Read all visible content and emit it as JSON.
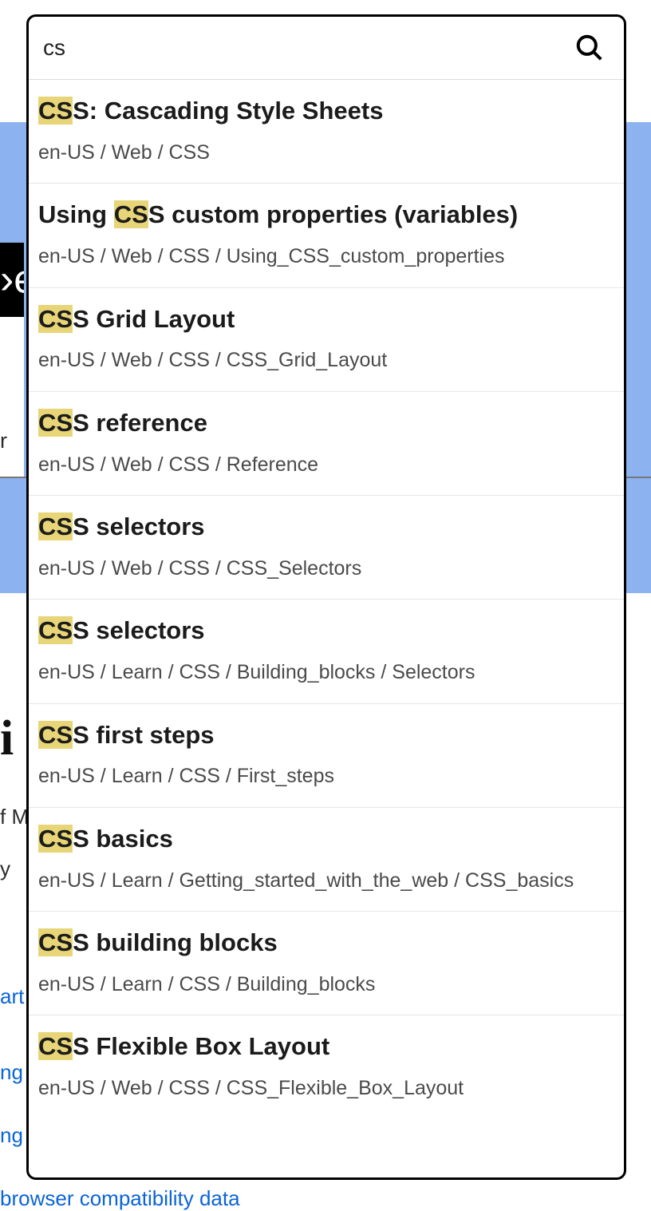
{
  "search": {
    "value": "cs",
    "highlight": "CS"
  },
  "results": [
    {
      "title_before": "",
      "title_after": "S: Cascading Style Sheets",
      "path": "en-US / Web / CSS"
    },
    {
      "pre": "Using ",
      "title_before": "",
      "title_after": "S custom properties (variables)",
      "path": "en-US / Web / CSS / Using_CSS_custom_properties"
    },
    {
      "title_before": "",
      "title_after": "S Grid Layout",
      "path": "en-US / Web / CSS / CSS_Grid_Layout"
    },
    {
      "title_before": "",
      "title_after": "S reference",
      "path": "en-US / Web / CSS / Reference"
    },
    {
      "title_before": "",
      "title_after": "S selectors",
      "path": "en-US / Web / CSS / CSS_Selectors"
    },
    {
      "title_before": "",
      "title_after": "S selectors",
      "path": "en-US / Learn / CSS / Building_blocks / Selectors"
    },
    {
      "title_before": "",
      "title_after": "S first steps",
      "path": "en-US / Learn / CSS / First_steps"
    },
    {
      "title_before": "",
      "title_after": "S basics",
      "path": "en-US / Learn / Getting_started_with_the_web / CSS_basics"
    },
    {
      "title_before": "",
      "title_after": "S building blocks",
      "path": "en-US / Learn / CSS / Building_blocks"
    },
    {
      "title_before": "",
      "title_after": "S Flexible Box Layout",
      "path": "en-US / Web / CSS / CSS_Flexible_Box_Layout"
    }
  ],
  "background": {
    "logo_fragment": "›ϵ",
    "r_fragment": "r ",
    "heading_fragment": "i",
    "f_fragment": "f M",
    "y_fragment": "y ",
    "art_fragment": "art",
    "ng_fragment1": "ng",
    "ng_fragment2": "ng",
    "browser_fragment": "browser compatibility data"
  }
}
